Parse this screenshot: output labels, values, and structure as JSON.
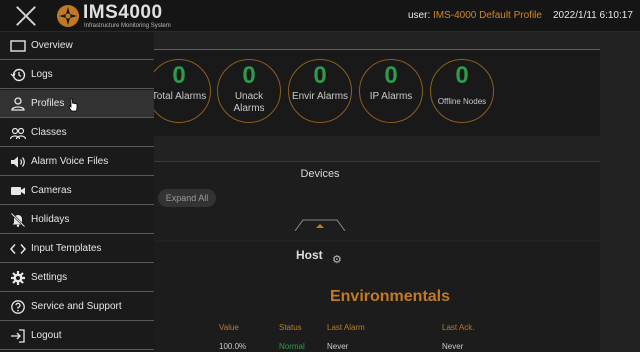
{
  "header": {
    "logo_title": "IMS4000",
    "logo_subtitle": "Infrastructure Monitoring System",
    "user_label": "user:",
    "user_profile": "IMS-4000 Default Profile",
    "datetime": "2022/1/11 6:10:17"
  },
  "summary": {
    "alarms": [
      {
        "count": "0",
        "label": "Total Alarms"
      },
      {
        "count": "0",
        "label": "Unack Alarms"
      },
      {
        "count": "0",
        "label": "Envir Alarms"
      },
      {
        "count": "0",
        "label": "IP Alarms"
      },
      {
        "count": "0",
        "label": "Offline Nodes"
      }
    ]
  },
  "devices": {
    "title": "Devices",
    "expand_label": "Expand All"
  },
  "host": {
    "title": "Host",
    "section_title": "Environmentals",
    "columns": [
      "Value",
      "Status",
      "Last Alarm",
      "Last Ack."
    ],
    "row": [
      "100.0%",
      "Normal",
      "Never",
      "Never"
    ]
  },
  "menu": {
    "items": [
      {
        "label": "Overview",
        "icon": "overview-icon"
      },
      {
        "label": "Logs",
        "icon": "history-icon"
      },
      {
        "label": "Profiles",
        "icon": "user-icon"
      },
      {
        "label": "Classes",
        "icon": "users-icon"
      },
      {
        "label": "Alarm Voice Files",
        "icon": "speaker-icon"
      },
      {
        "label": "Cameras",
        "icon": "camera-icon"
      },
      {
        "label": "Holidays",
        "icon": "bell-off-icon"
      },
      {
        "label": "Input Templates",
        "icon": "code-icon"
      },
      {
        "label": "Settings",
        "icon": "gear-icon"
      },
      {
        "label": "Service and Support",
        "icon": "help-icon"
      },
      {
        "label": "Logout",
        "icon": "logout-icon"
      }
    ],
    "active_index": 2
  },
  "colors": {
    "accent": "#c07a26",
    "ok": "#2f9a4b",
    "background": "#1e1e1e"
  }
}
